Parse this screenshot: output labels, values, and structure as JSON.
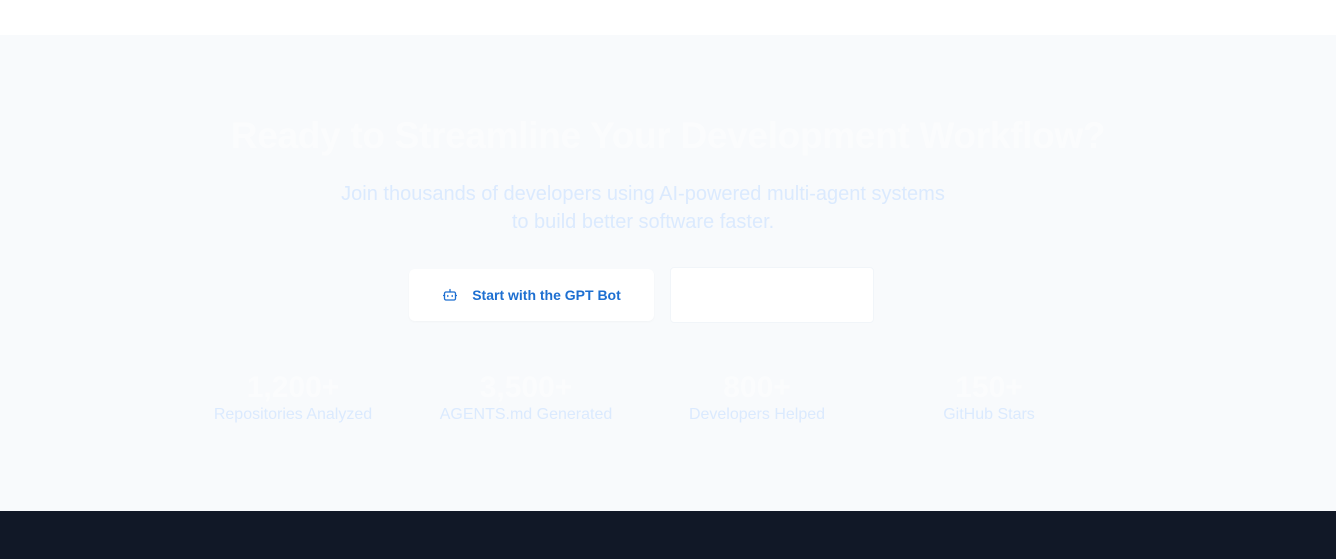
{
  "cta": {
    "title": "Ready to Streamline Your Development Workflow?",
    "subtitle_line1": "Join thousands of developers using AI-powered multi-agent systems",
    "subtitle_line2": "to build better software faster.",
    "primary_button": {
      "label": "Start with the GPT Bot",
      "icon": "robot-icon"
    },
    "secondary_button": {
      "label": ""
    }
  },
  "stats": [
    {
      "value": "1,200+",
      "label": "Repositories Analyzed"
    },
    {
      "value": "3,500+",
      "label": "AGENTS.md Generated"
    },
    {
      "value": "800+",
      "label": "Developers Helped"
    },
    {
      "value": "150+",
      "label": "GitHub Stars"
    }
  ],
  "colors": {
    "section_bg": "#f8fafc",
    "footer_bg": "#111827",
    "accent": "#1d6fd1",
    "muted_text": "#dbeafe"
  }
}
